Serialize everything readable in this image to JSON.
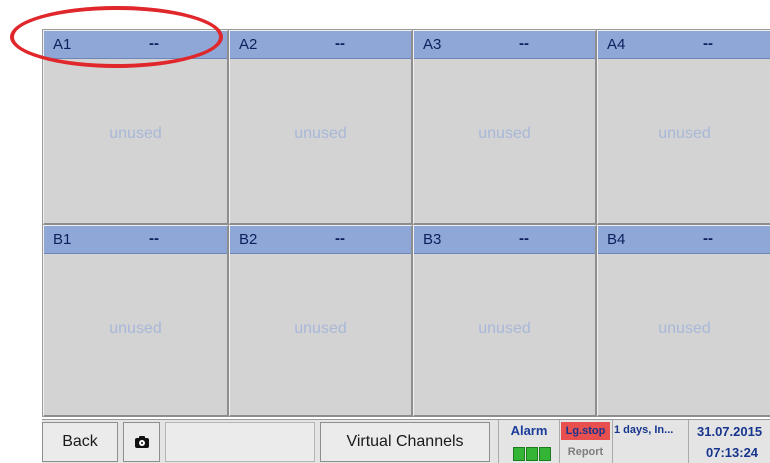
{
  "channels": {
    "row_a": [
      {
        "id": "A1",
        "value": "--",
        "status": "unused"
      },
      {
        "id": "A2",
        "value": "--",
        "status": "unused"
      },
      {
        "id": "A3",
        "value": "--",
        "status": "unused"
      },
      {
        "id": "A4",
        "value": "--",
        "status": "unused"
      }
    ],
    "row_b": [
      {
        "id": "B1",
        "value": "--",
        "status": "unused"
      },
      {
        "id": "B2",
        "value": "--",
        "status": "unused"
      },
      {
        "id": "B3",
        "value": "--",
        "status": "unused"
      },
      {
        "id": "B4",
        "value": "--",
        "status": "unused"
      }
    ]
  },
  "toolbar": {
    "back_label": "Back",
    "camera_icon": "camera-icon",
    "virtual_channels_label": "Virtual Channels"
  },
  "status": {
    "alarm_label": "Alarm",
    "alarm_led_count": 3,
    "alarm_led_color": "#35b535",
    "logger_state": "Lg.stop",
    "logger_state_color": "#e84f4f",
    "report_label": "Report",
    "log_interval": "1 days, In...",
    "date": "31.07.2015",
    "time": "07:13:24"
  },
  "colors": {
    "header": "#8fa7d6",
    "tile": "#d3d3d3",
    "status_text": "#a8b8d8",
    "callout": "#e0272b"
  }
}
